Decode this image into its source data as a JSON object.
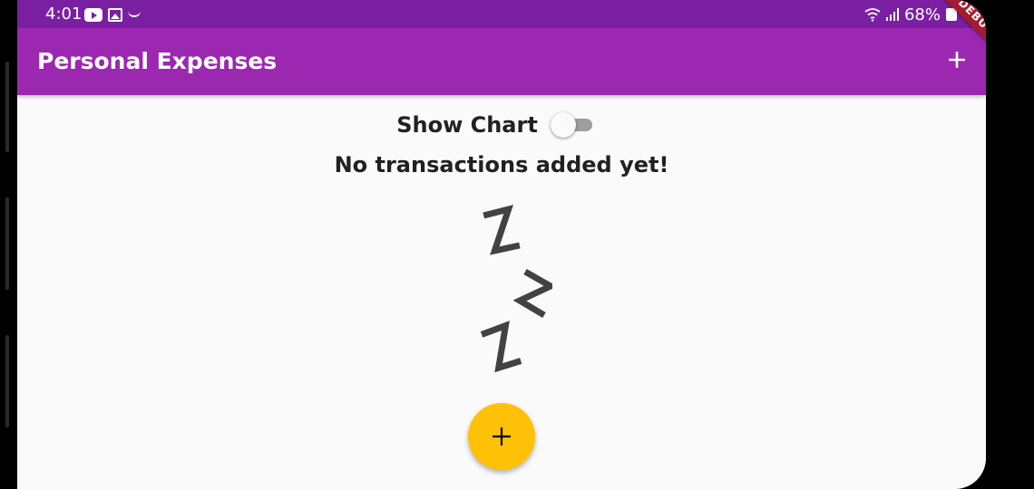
{
  "status_bar": {
    "time": "4:01",
    "battery": "68%",
    "left_icons": [
      "youtube-icon",
      "gallery-icon",
      "smile-icon"
    ],
    "right_icons": [
      "wifi-icon",
      "signal-icon",
      "battery-icon"
    ]
  },
  "app_bar": {
    "title": "Personal Expenses",
    "action_icon": "add-icon",
    "color": "#9c27b0"
  },
  "debug_banner": {
    "label": "DEBUG"
  },
  "chart_switch": {
    "label": "Show Chart",
    "on": false
  },
  "empty_state": {
    "message": "No transactions added yet!",
    "image": "sleeping-zzz-image"
  },
  "fab": {
    "icon": "add-icon",
    "color": "#ffc107"
  },
  "colors": {
    "status_bar": "#7b1fa2",
    "background": "#fafafa",
    "text": "#212121"
  }
}
